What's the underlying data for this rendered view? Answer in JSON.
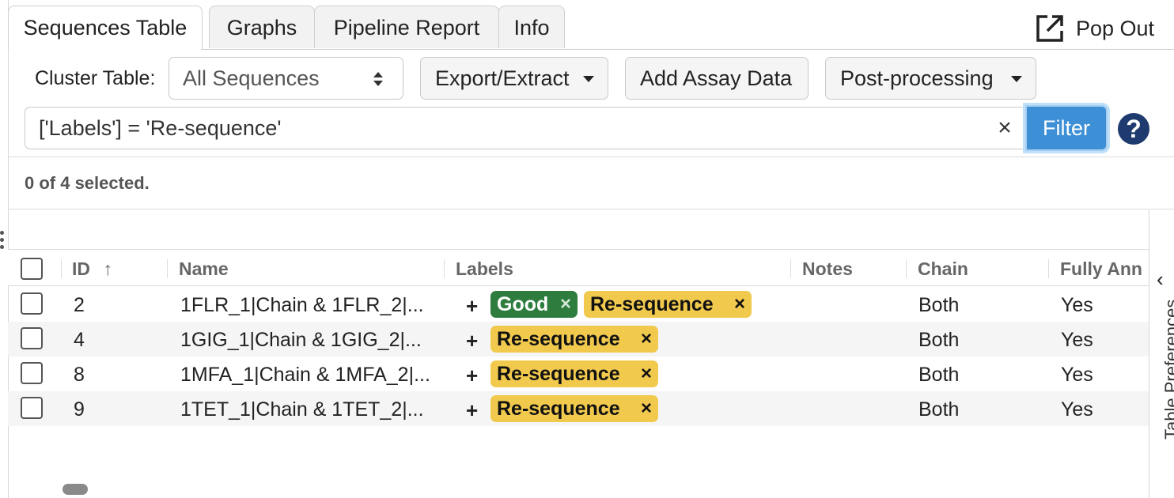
{
  "tabs": [
    {
      "label": "Sequences Table"
    },
    {
      "label": "Graphs"
    },
    {
      "label": "Pipeline Report"
    },
    {
      "label": "Info"
    }
  ],
  "popout": {
    "label": "Pop Out",
    "icon": "external-link-icon"
  },
  "toolbar": {
    "cluster_label": "Cluster Table:",
    "cluster_select_value": "All Sequences",
    "export_label": "Export/Extract",
    "assay_label": "Add Assay Data",
    "postprocess_label": "Post-processing"
  },
  "filter": {
    "query": "['Labels'] = 'Re-sequence'",
    "clear_symbol": "×",
    "button_label": "Filter",
    "help_symbol": "?"
  },
  "selection": {
    "text": "0 of 4 selected."
  },
  "table": {
    "columns": {
      "id": "ID",
      "id_sort_symbol": "↑",
      "name": "Name",
      "labels": "Labels",
      "notes": "Notes",
      "chain": "Chain",
      "fully_annotated": "Fully Ann"
    },
    "rows": [
      {
        "id": "2",
        "name": "1FLR_1|Chain & 1FLR_2|...",
        "labels": [
          "Good",
          "Re-sequence"
        ],
        "chain": "Both",
        "fully": "Yes"
      },
      {
        "id": "4",
        "name": "1GIG_1|Chain & 1GIG_2|...",
        "labels": [
          "Re-sequence"
        ],
        "chain": "Both",
        "fully": "Yes"
      },
      {
        "id": "8",
        "name": "1MFA_1|Chain & 1MFA_2|...",
        "labels": [
          "Re-sequence"
        ],
        "chain": "Both",
        "fully": "Yes"
      },
      {
        "id": "9",
        "name": "1TET_1|Chain & 1TET_2|...",
        "labels": [
          "Re-sequence"
        ],
        "chain": "Both",
        "fully": "Yes"
      }
    ],
    "add_label_symbol": "+",
    "remove_label_symbol": "×"
  },
  "side_panel": {
    "label": "Table Preferences",
    "chevron": "‹"
  },
  "colors": {
    "accent": "#3d8fd6",
    "good_tag": "#2e7d3f",
    "reseq_tag": "#f0c94d",
    "help": "#1e3a6e"
  }
}
